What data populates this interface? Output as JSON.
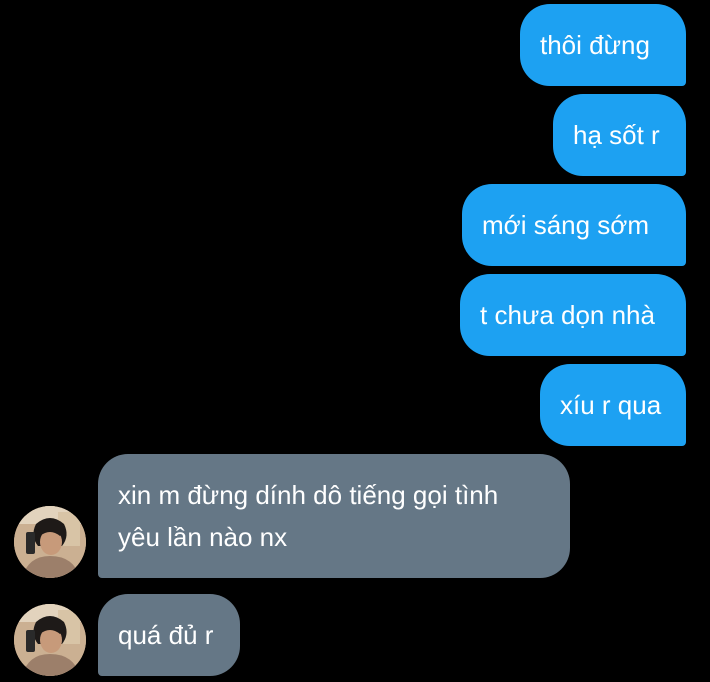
{
  "messages": {
    "outgoing": [
      {
        "text": "thôi đừng"
      },
      {
        "text": "hạ sốt r"
      },
      {
        "text": "mới sáng sớm"
      },
      {
        "text": "t chưa dọn nhà"
      },
      {
        "text": "xíu r qua"
      }
    ],
    "incoming": [
      {
        "lines": [
          "xin m đừng dính dô tiếng gọi tình",
          "yêu lần nào nx"
        ]
      },
      {
        "lines": [
          "quá đủ r"
        ]
      }
    ]
  },
  "colors": {
    "background": "#000000",
    "outgoing_bubble": "#1da1f2",
    "incoming_bubble": "#657786",
    "text": "#ffffff"
  },
  "icons": {
    "avatar": "user-avatar-photo"
  }
}
